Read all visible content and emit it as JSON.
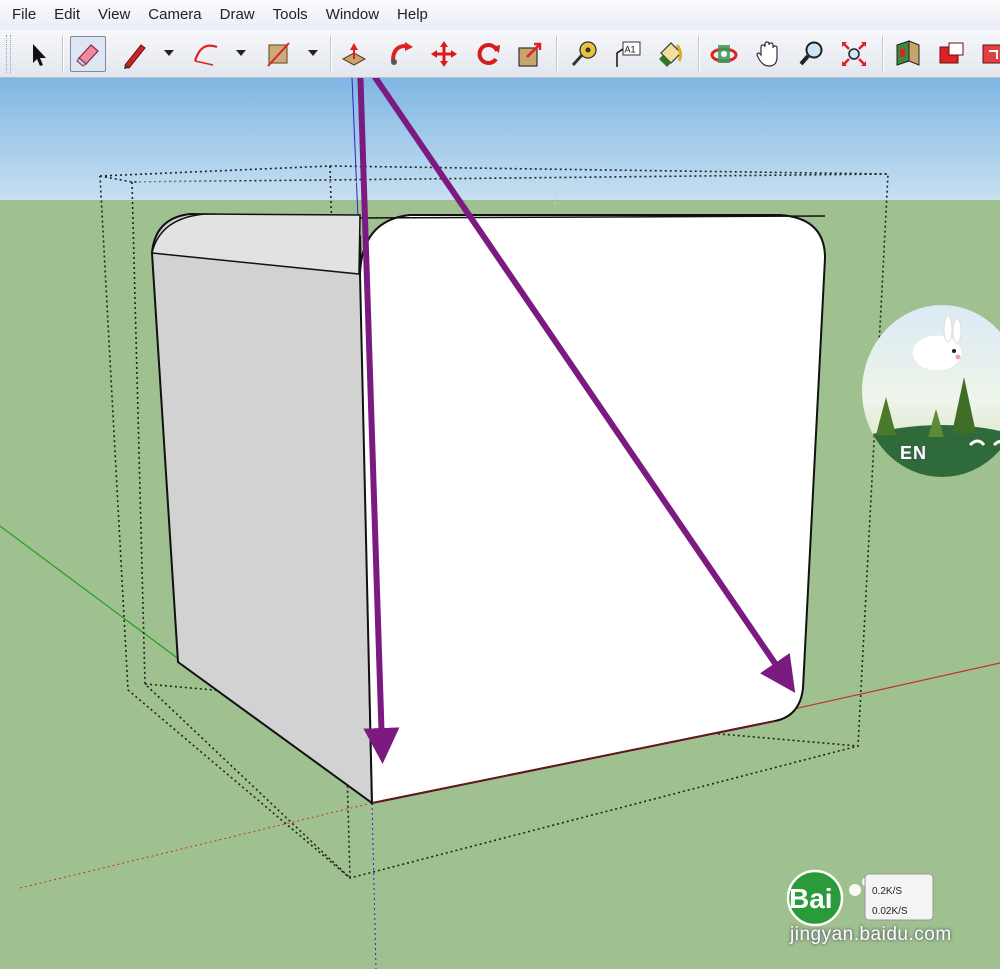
{
  "menu": [
    "File",
    "Edit",
    "View",
    "Camera",
    "Draw",
    "Tools",
    "Window",
    "Help"
  ],
  "toolbar": {
    "tools": [
      {
        "name": "select-icon"
      },
      {
        "name": "eraser-icon"
      },
      {
        "name": "pencil-line-icon"
      },
      {
        "name": "arc-icon"
      },
      {
        "name": "rectangle-icon"
      },
      {
        "name": "push-pull-icon"
      },
      {
        "name": "follow-me-icon"
      },
      {
        "name": "move-icon"
      },
      {
        "name": "rotate-icon"
      },
      {
        "name": "scale-icon"
      },
      {
        "name": "tape-measure-icon"
      },
      {
        "name": "text-icon"
      },
      {
        "name": "paint-bucket-icon"
      },
      {
        "name": "orbit-icon"
      },
      {
        "name": "pan-icon"
      },
      {
        "name": "zoom-icon"
      },
      {
        "name": "zoom-extents-icon"
      },
      {
        "name": "warehouse-icon"
      },
      {
        "name": "component-icon"
      },
      {
        "name": "extension-icon"
      }
    ],
    "text_tool_glyph": "A1"
  },
  "ime": {
    "label": "EN"
  },
  "watermark": {
    "brand": "Bai",
    "site": "jingyan.baidu.com",
    "line1": "0.2K/S",
    "line2": "0.02K/S"
  },
  "colors": {
    "sky": "#a6cdea",
    "ground": "#9fc08f",
    "arrow": "#7b1b82",
    "axis_red": "#c53030",
    "axis_green": "#1ea01e",
    "axis_blue": "#2828c8"
  }
}
